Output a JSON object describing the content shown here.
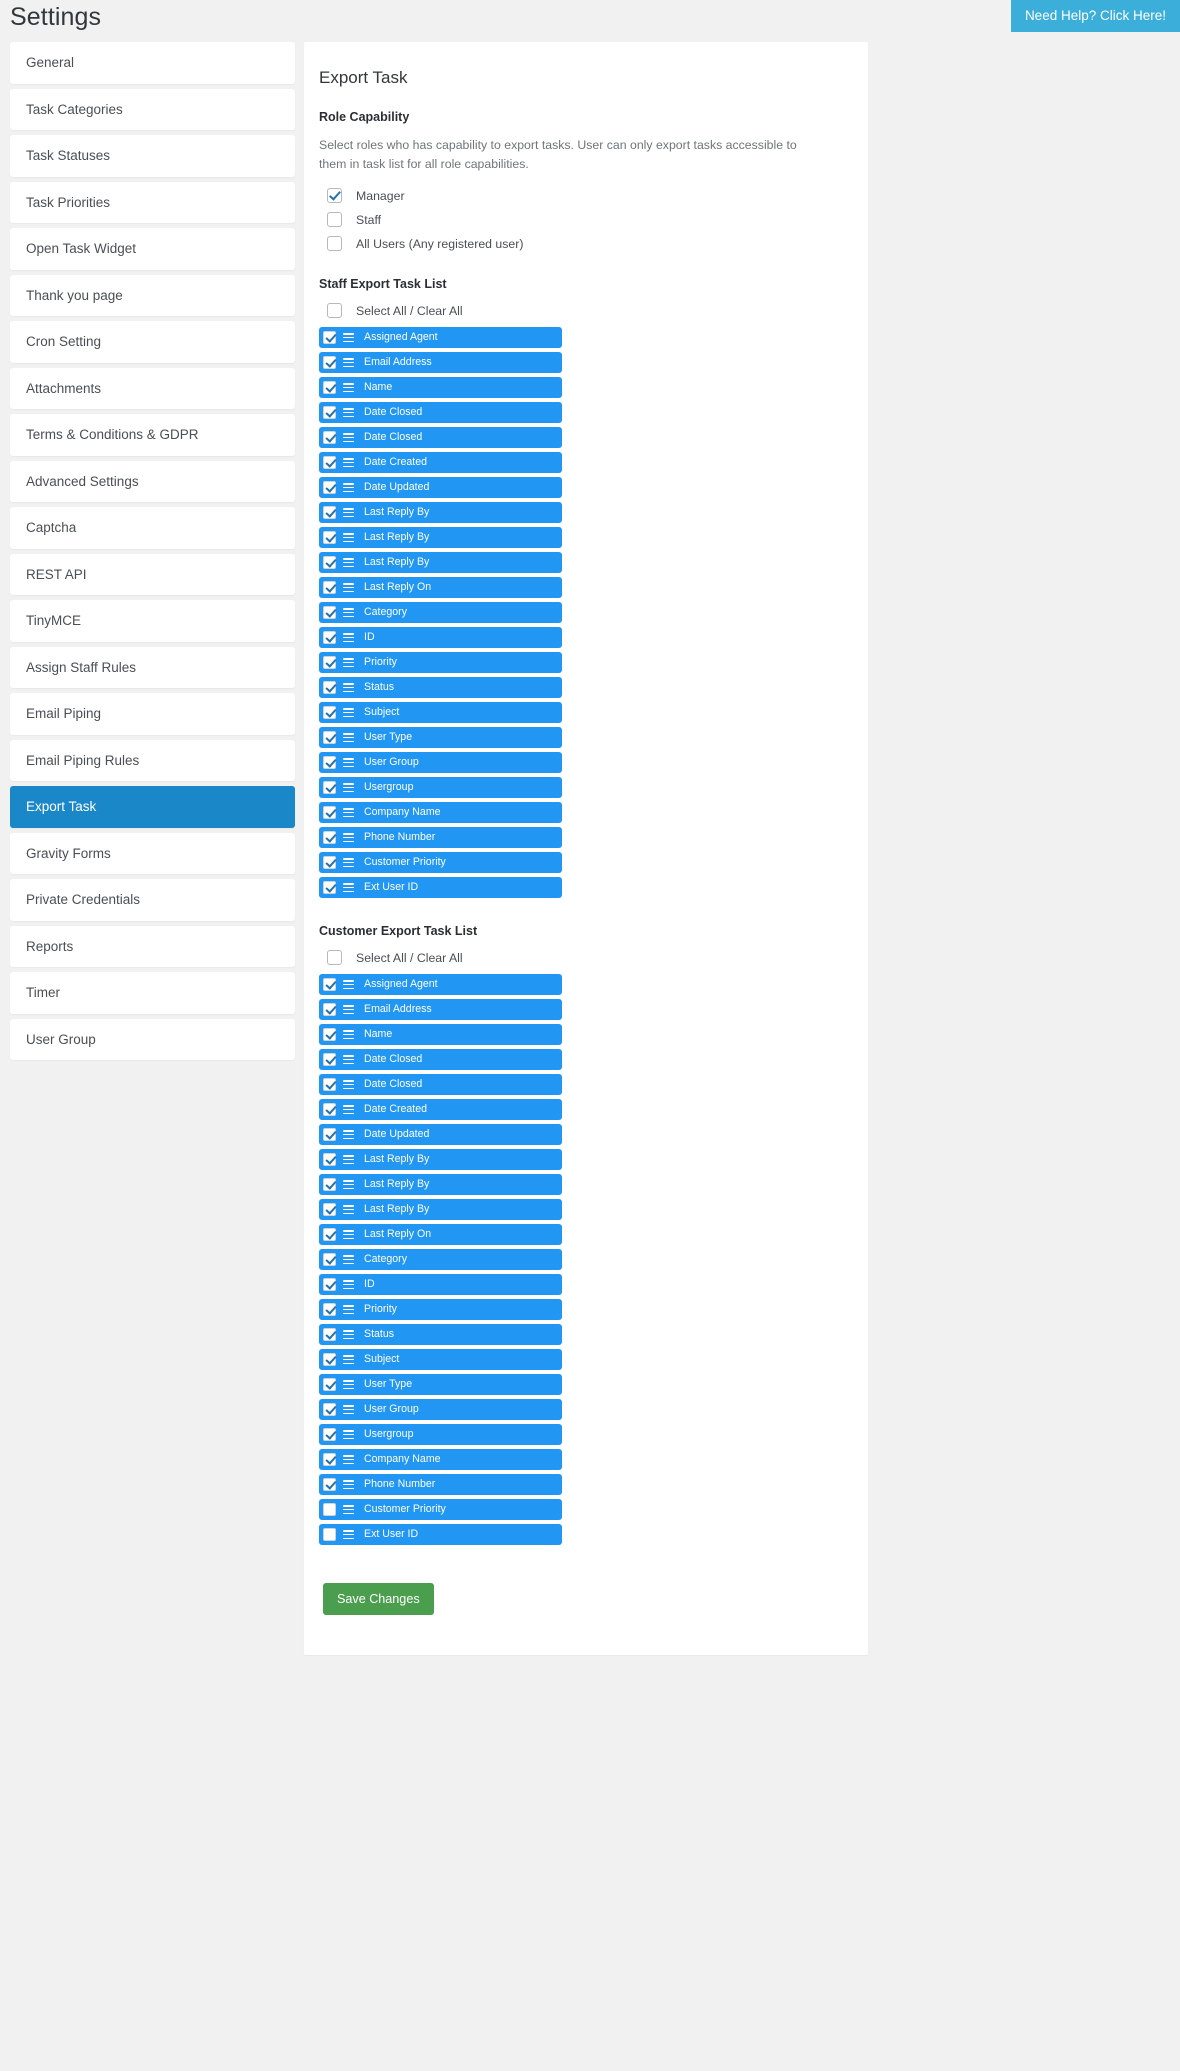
{
  "header": {
    "title": "Settings",
    "help_button": "Need Help? Click Here!"
  },
  "sidebar": {
    "items": [
      {
        "label": "General",
        "active": false
      },
      {
        "label": "Task Categories",
        "active": false
      },
      {
        "label": "Task Statuses",
        "active": false
      },
      {
        "label": "Task Priorities",
        "active": false
      },
      {
        "label": "Open Task Widget",
        "active": false
      },
      {
        "label": "Thank you page",
        "active": false
      },
      {
        "label": "Cron Setting",
        "active": false
      },
      {
        "label": "Attachments",
        "active": false
      },
      {
        "label": "Terms & Conditions & GDPR",
        "active": false
      },
      {
        "label": "Advanced Settings",
        "active": false
      },
      {
        "label": "Captcha",
        "active": false
      },
      {
        "label": "REST API",
        "active": false
      },
      {
        "label": "TinyMCE",
        "active": false
      },
      {
        "label": "Assign Staff Rules",
        "active": false
      },
      {
        "label": "Email Piping",
        "active": false
      },
      {
        "label": "Email Piping Rules",
        "active": false
      },
      {
        "label": "Export Task",
        "active": true
      },
      {
        "label": "Gravity Forms",
        "active": false
      },
      {
        "label": "Private Credentials",
        "active": false
      },
      {
        "label": "Reports",
        "active": false
      },
      {
        "label": "Timer",
        "active": false
      },
      {
        "label": "User Group",
        "active": false
      }
    ]
  },
  "main": {
    "title": "Export Task",
    "role_capability": {
      "heading": "Role Capability",
      "description": "Select roles who has capability to export tasks. User can only export tasks accessible to them in task list for all role capabilities.",
      "roles": [
        {
          "label": "Manager",
          "checked": true
        },
        {
          "label": "Staff",
          "checked": false
        },
        {
          "label": "All Users (Any registered user)",
          "checked": false
        }
      ]
    },
    "staff_list": {
      "heading": "Staff Export Task List",
      "select_all_label": "Select All / Clear All",
      "select_all_checked": false,
      "items": [
        {
          "label": "Assigned Agent",
          "checked": true
        },
        {
          "label": "Email Address",
          "checked": true
        },
        {
          "label": "Name",
          "checked": true
        },
        {
          "label": "Date Closed",
          "checked": true
        },
        {
          "label": "Date Closed",
          "checked": true
        },
        {
          "label": "Date Created",
          "checked": true
        },
        {
          "label": "Date Updated",
          "checked": true
        },
        {
          "label": "Last Reply By",
          "checked": true
        },
        {
          "label": "Last Reply By",
          "checked": true
        },
        {
          "label": "Last Reply By",
          "checked": true
        },
        {
          "label": "Last Reply On",
          "checked": true
        },
        {
          "label": "Category",
          "checked": true
        },
        {
          "label": "ID",
          "checked": true
        },
        {
          "label": "Priority",
          "checked": true
        },
        {
          "label": "Status",
          "checked": true
        },
        {
          "label": "Subject",
          "checked": true
        },
        {
          "label": "User Type",
          "checked": true
        },
        {
          "label": "User Group",
          "checked": true
        },
        {
          "label": "Usergroup",
          "checked": true
        },
        {
          "label": "Company Name",
          "checked": true
        },
        {
          "label": "Phone Number",
          "checked": true
        },
        {
          "label": "Customer Priority",
          "checked": true
        },
        {
          "label": "Ext User ID",
          "checked": true
        }
      ]
    },
    "customer_list": {
      "heading": "Customer Export Task List",
      "select_all_label": "Select All / Clear All",
      "select_all_checked": false,
      "items": [
        {
          "label": "Assigned Agent",
          "checked": true
        },
        {
          "label": "Email Address",
          "checked": true
        },
        {
          "label": "Name",
          "checked": true
        },
        {
          "label": "Date Closed",
          "checked": true
        },
        {
          "label": "Date Closed",
          "checked": true
        },
        {
          "label": "Date Created",
          "checked": true
        },
        {
          "label": "Date Updated",
          "checked": true
        },
        {
          "label": "Last Reply By",
          "checked": true
        },
        {
          "label": "Last Reply By",
          "checked": true
        },
        {
          "label": "Last Reply By",
          "checked": true
        },
        {
          "label": "Last Reply On",
          "checked": true
        },
        {
          "label": "Category",
          "checked": true
        },
        {
          "label": "ID",
          "checked": true
        },
        {
          "label": "Priority",
          "checked": true
        },
        {
          "label": "Status",
          "checked": true
        },
        {
          "label": "Subject",
          "checked": true
        },
        {
          "label": "User Type",
          "checked": true
        },
        {
          "label": "User Group",
          "checked": true
        },
        {
          "label": "Usergroup",
          "checked": true
        },
        {
          "label": "Company Name",
          "checked": true
        },
        {
          "label": "Phone Number",
          "checked": true
        },
        {
          "label": "Customer Priority",
          "checked": false
        },
        {
          "label": "Ext User ID",
          "checked": false
        }
      ]
    },
    "save_label": "Save Changes"
  },
  "colors": {
    "accent_blue": "#1a87c9",
    "pill_blue": "#2196f3",
    "help_blue": "#3bafda",
    "save_green": "#4a9e4e"
  }
}
